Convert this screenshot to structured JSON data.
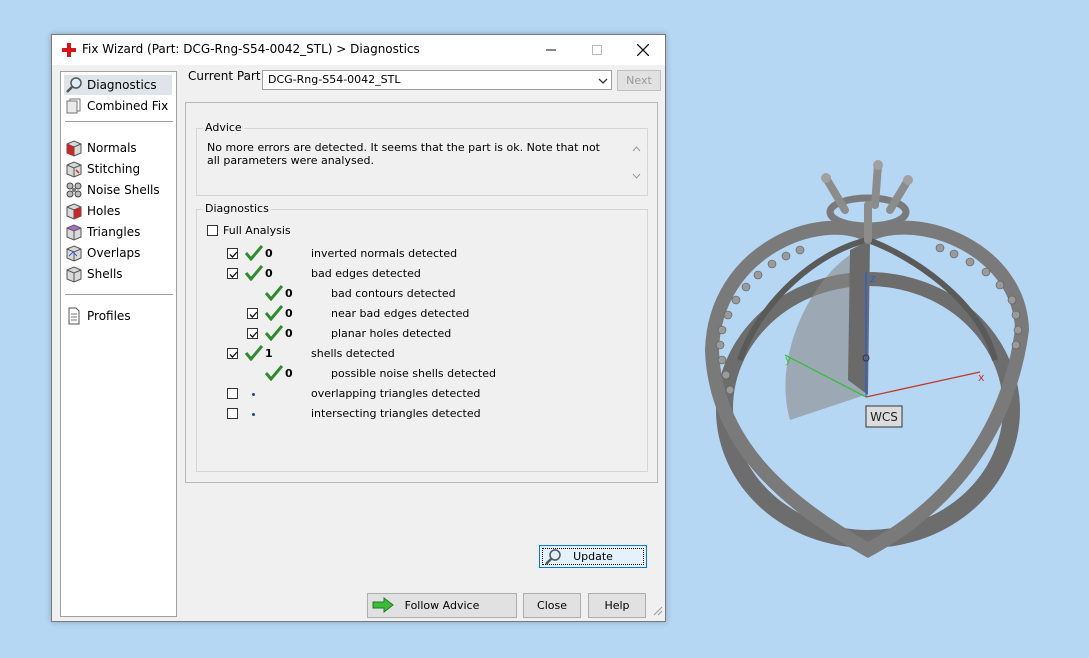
{
  "window": {
    "title": "Fix Wizard (Part: DCG-Rng-S54-0042_STL) > Diagnostics",
    "minimize": "—",
    "close": "✕"
  },
  "nav": {
    "items": [
      {
        "label": "Diagnostics",
        "icon": "magnifier-icon",
        "selected": true
      },
      {
        "label": "Combined Fix",
        "icon": "combined-fix-icon"
      },
      {
        "label": "Normals",
        "icon": "normals-icon"
      },
      {
        "label": "Stitching",
        "icon": "stitching-icon"
      },
      {
        "label": "Noise Shells",
        "icon": "noise-shells-icon"
      },
      {
        "label": "Holes",
        "icon": "holes-icon"
      },
      {
        "label": "Triangles",
        "icon": "triangles-icon"
      },
      {
        "label": "Overlaps",
        "icon": "overlaps-icon"
      },
      {
        "label": "Shells",
        "icon": "shells-icon"
      },
      {
        "label": "Profiles",
        "icon": "document-icon"
      }
    ]
  },
  "current_part": {
    "label": "Current Part:",
    "value": "DCG-Rng-S54-0042_STL",
    "next_label": "Next"
  },
  "advice": {
    "label": "Advice",
    "text": "No more errors are detected. It seems that the part is ok. Note that not all parameters were analysed."
  },
  "diagnostics": {
    "label": "Diagnostics",
    "full_analysis_label": "Full Analysis",
    "full_analysis_checked": false,
    "rows": [
      {
        "checkbox": true,
        "checked": true,
        "status": "ok",
        "count": "0",
        "label": "inverted normals detected",
        "indent": 0
      },
      {
        "checkbox": true,
        "checked": true,
        "status": "ok",
        "count": "0",
        "label": "bad edges detected",
        "indent": 0
      },
      {
        "checkbox": false,
        "checked": false,
        "status": "ok",
        "count": "0",
        "label": "bad contours detected",
        "indent": 1
      },
      {
        "checkbox": true,
        "checked": true,
        "status": "ok",
        "count": "0",
        "label": "near bad edges detected",
        "indent": 1
      },
      {
        "checkbox": true,
        "checked": true,
        "status": "ok",
        "count": "0",
        "label": "planar holes detected",
        "indent": 1
      },
      {
        "checkbox": true,
        "checked": true,
        "status": "ok",
        "count": "1",
        "label": "shells detected",
        "indent": 0
      },
      {
        "checkbox": false,
        "checked": false,
        "status": "ok",
        "count": "0",
        "label": "possible noise shells detected",
        "indent": 1
      },
      {
        "checkbox": true,
        "checked": false,
        "status": "unknown",
        "count": "",
        "label": "overlapping triangles detected",
        "indent": 0
      },
      {
        "checkbox": true,
        "checked": false,
        "status": "unknown",
        "count": "",
        "label": "intersecting triangles detected",
        "indent": 0
      }
    ],
    "update_label": "Update"
  },
  "buttons": {
    "follow_advice": "Follow Advice",
    "close": "Close",
    "help": "Help"
  },
  "viewport": {
    "wcs_label": "WCS",
    "axis_x": "x",
    "axis_y": "y",
    "axis_z": "z"
  },
  "colors": {
    "background": "#b6d7f4",
    "check_green": "#2e8b2e",
    "accent_blue": "#0078d7",
    "axis_x": "#c0392b",
    "axis_y": "#3cbc3c",
    "axis_z": "#2a5cd6"
  }
}
